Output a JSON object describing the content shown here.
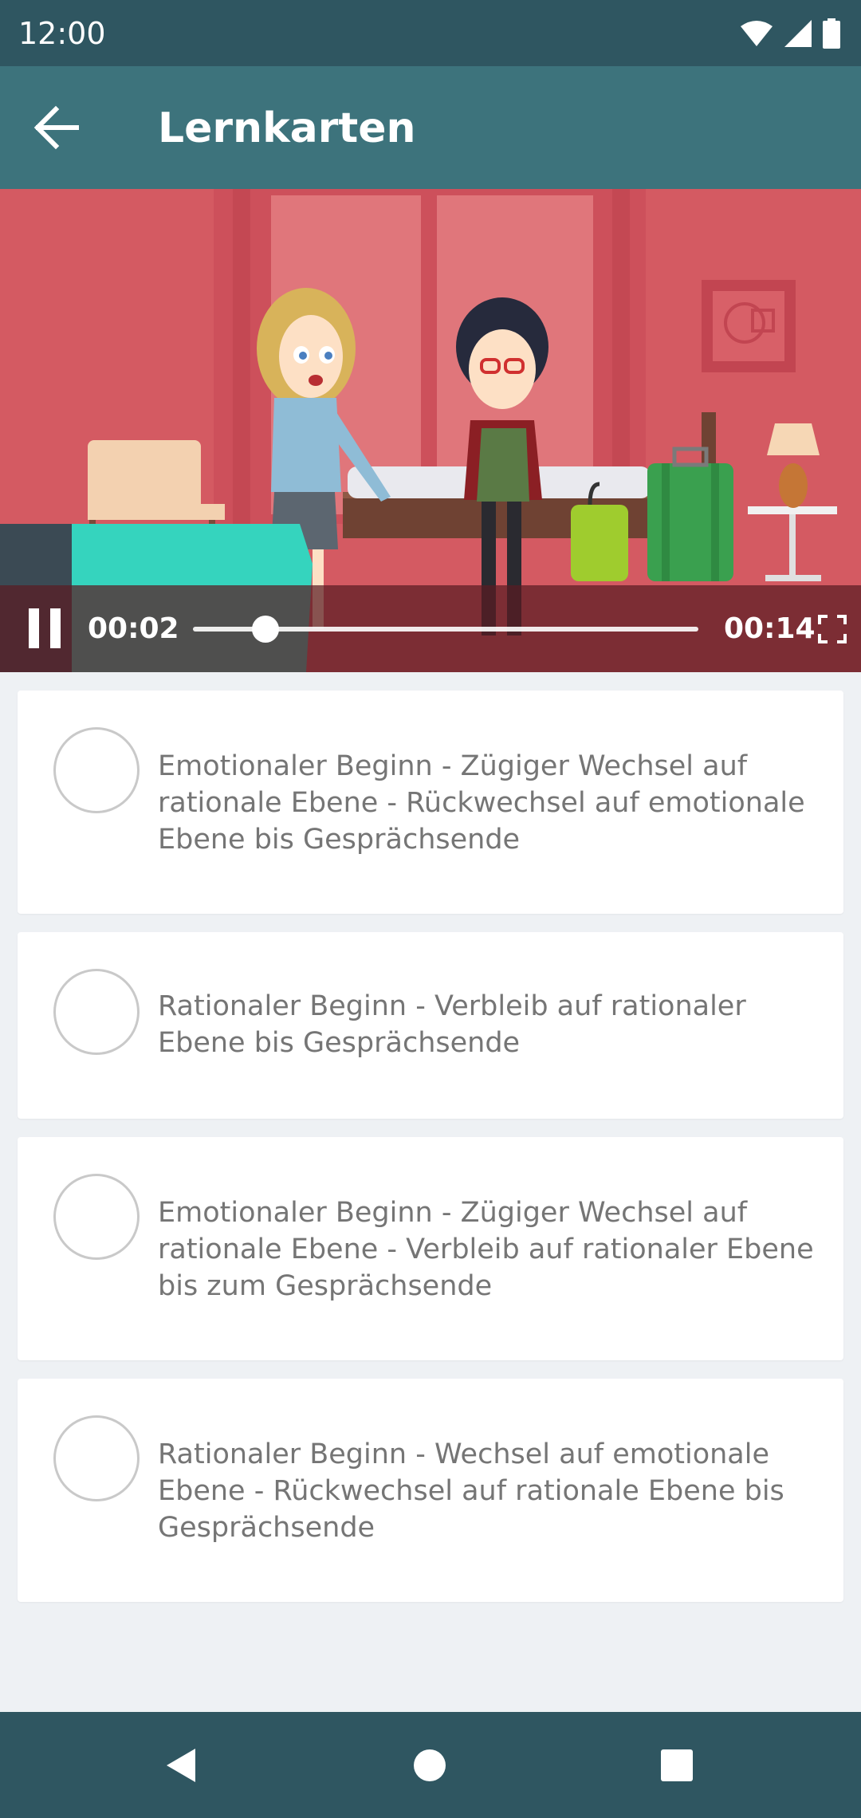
{
  "status_bar": {
    "time": "12:00",
    "icons": [
      "wifi-icon",
      "signal-icon",
      "battery-icon"
    ]
  },
  "app_bar": {
    "title": "Lernkarten",
    "back_icon": "arrow-left-icon"
  },
  "video": {
    "current_time": "00:02",
    "total_time": "00:14",
    "progress": 0.143,
    "play_state_icon": "pause-icon",
    "fullscreen_icon": "fullscreen-icon"
  },
  "answers": [
    {
      "text": "Emotionaler Beginn - Zügiger Wechsel auf rationale Ebene - Rückwechsel auf emotionale Ebene bis Gesprächsende",
      "selected": false
    },
    {
      "text": "Rationaler Beginn - Verbleib auf rationaler Ebene bis Gesprächsende",
      "selected": false
    },
    {
      "text": "Emotionaler Beginn - Zügiger Wechsel auf rationale Ebene - Verbleib auf rationaler Ebene bis zum Gesprächsende",
      "selected": false
    },
    {
      "text": "Rationaler Beginn - Wechsel auf emotionale Ebene - Rückwechsel auf rationale Ebene bis Gesprächsende",
      "selected": false
    }
  ],
  "nav_bar": {
    "icons": [
      "nav-back-icon",
      "nav-home-icon",
      "nav-recents-icon"
    ]
  },
  "colors": {
    "status_bar": "#2f5661",
    "app_bar": "#3d737c",
    "teal_accent": "#35d4be",
    "background": "#eef1f4"
  }
}
